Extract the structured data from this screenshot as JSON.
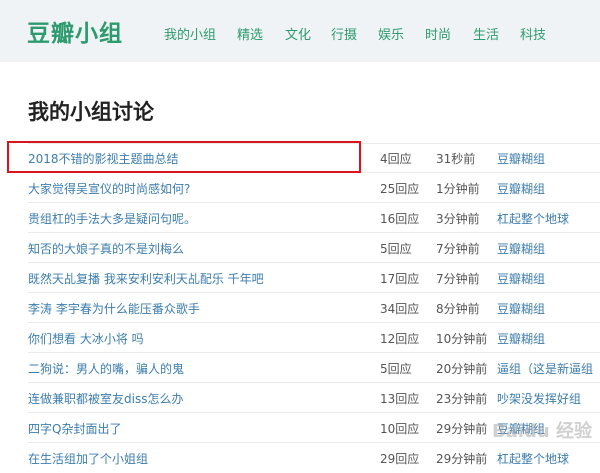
{
  "header": {
    "logo": "豆瓣小组",
    "nav": [
      "我的小组",
      "精选",
      "文化",
      "行摄",
      "娱乐",
      "时尚",
      "生活",
      "科技"
    ]
  },
  "main": {
    "title": "我的小组讨论",
    "rows": [
      {
        "title": "2018不错的影视主题曲总结",
        "replies": "4回应",
        "time": "31秒前",
        "group": "豆瓣糊组"
      },
      {
        "title": "大家觉得吴宣仪的时尚感如何?",
        "replies": "25回应",
        "time": "1分钟前",
        "group": "豆瓣糊组"
      },
      {
        "title": "贵组杠的手法大多是疑问句呢。",
        "replies": "16回应",
        "time": "3分钟前",
        "group": "杠起整个地球"
      },
      {
        "title": "知否的大娘子真的不是刘梅么",
        "replies": "5回应",
        "time": "7分钟前",
        "group": "豆瓣糊组"
      },
      {
        "title": "既然天乩复播 我来安利安利天乩配乐 千年吧",
        "replies": "17回应",
        "time": "7分钟前",
        "group": "豆瓣糊组"
      },
      {
        "title": "李涛 李宇春为什么能压番众歌手",
        "replies": "34回应",
        "time": "8分钟前",
        "group": "豆瓣糊组"
      },
      {
        "title": "你们想看 大冰小将 吗",
        "replies": "12回应",
        "time": "10分钟前",
        "group": "豆瓣糊组"
      },
      {
        "title": "二狗说：男人的嘴，骗人的鬼",
        "replies": "5回应",
        "time": "20分钟前",
        "group": "逼组（这是新逼组"
      },
      {
        "title": "连做兼职都被室友diss怎么办",
        "replies": "13回应",
        "time": "23分钟前",
        "group": "吵架没发挥好组"
      },
      {
        "title": "四字Q杂封面出了",
        "replies": "10回应",
        "time": "29分钟前",
        "group": "豆瓣糊组"
      },
      {
        "title": "在生活组加了个小姐组",
        "replies": "29回应",
        "time": "29分钟前",
        "group": "杠起整个地球"
      }
    ]
  },
  "watermark": "Baidu 经验",
  "colors": {
    "brand": "#2e9b6e",
    "link": "#3d7dae",
    "highlight": "#d9141b",
    "topbar": "#f0f3f5"
  }
}
